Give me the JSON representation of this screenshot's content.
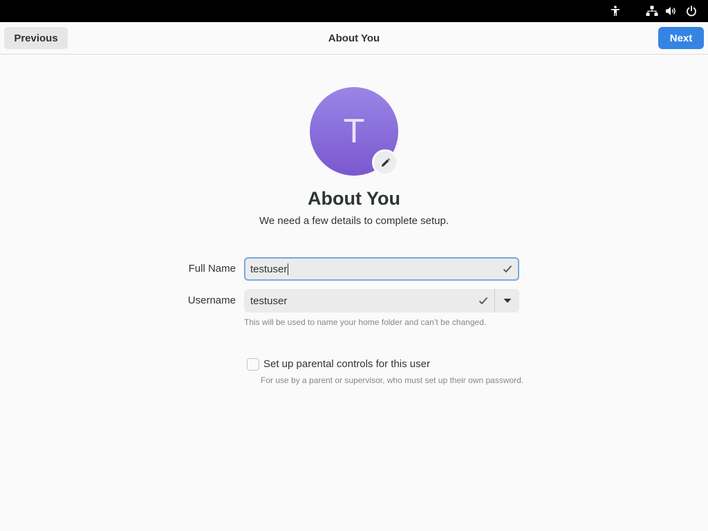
{
  "system_tray": {
    "icons": [
      "accessibility-icon",
      "network-icon",
      "volume-icon",
      "power-icon"
    ]
  },
  "header": {
    "previous_label": "Previous",
    "title": "About You",
    "next_label": "Next"
  },
  "avatar": {
    "initial": "T",
    "edit_icon": "pencil-icon"
  },
  "page": {
    "heading": "About You",
    "subtitle": "We need a few details to complete setup."
  },
  "form": {
    "full_name": {
      "label": "Full Name",
      "value": "testuser"
    },
    "username": {
      "label": "Username",
      "value": "testuser",
      "hint": "This will be used to name your home folder and can’t be changed."
    },
    "parental": {
      "label": "Set up parental controls for this user",
      "hint": "For use by a parent or supervisor, who must set up their own password."
    }
  },
  "colors": {
    "accent": "#3584e4",
    "avatar_top": "#9a86e6",
    "avatar_bottom": "#7a58cf",
    "focus_border": "#7aa8dc"
  }
}
